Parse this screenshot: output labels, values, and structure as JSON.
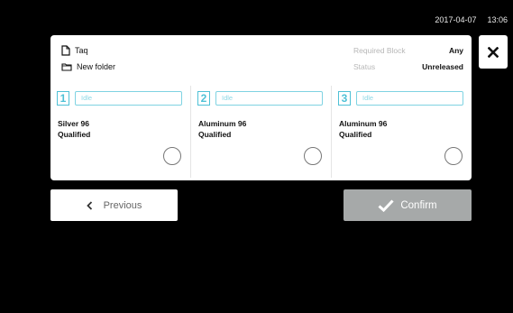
{
  "status_bar": {
    "date": "2017-04-07",
    "time": "13:06"
  },
  "protocol": {
    "name": "Taq",
    "folder": "New folder",
    "required_block_label": "Required Block",
    "required_block_value": "Any",
    "status_label": "Status",
    "status_value": "Unreleased"
  },
  "blocks": [
    {
      "number": "1",
      "state": "Idle",
      "name": "Silver 96",
      "qualification": "Qualified"
    },
    {
      "number": "2",
      "state": "Idle",
      "name": "Aluminum 96",
      "qualification": "Qualified"
    },
    {
      "number": "3",
      "state": "Idle",
      "name": "Aluminum 96",
      "qualification": "Qualified"
    }
  ],
  "buttons": {
    "previous": "Previous",
    "confirm": "Confirm"
  },
  "icons": {
    "file": "file-icon",
    "folder": "folder-icon",
    "close": "close-icon",
    "previous": "chevron-left-icon",
    "confirm": "checkmark-icon"
  },
  "colors": {
    "accent": "#4fc1d6",
    "confirm_disabled": "#a6a9a9",
    "background": "#000000"
  }
}
